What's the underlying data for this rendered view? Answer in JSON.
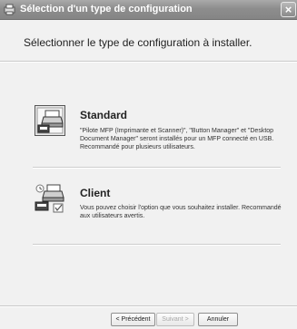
{
  "window": {
    "title": "Sélection d'un type de configuration",
    "close_glyph": "×"
  },
  "heading": "Sélectionner le type de configuration à installer.",
  "options": [
    {
      "title": "Standard",
      "description": "\"Pilote MFP (Imprimante et Scanner)\", \"Button Manager\" et \"Desktop Document Manager\" seront installés pour un MFP connecté en USB. Recommandé pour plusieurs utilisateurs.",
      "icon": "printer-setup-icon"
    },
    {
      "title": "Client",
      "description": "Vous pouvez choisir l'option que vous souhaitez installer. Recommandé aux utilisateurs avertis.",
      "icon": "printer-custom-icon"
    }
  ],
  "buttons": {
    "back": "< Précédent",
    "next": "Suivant >",
    "cancel": "Annuler"
  }
}
